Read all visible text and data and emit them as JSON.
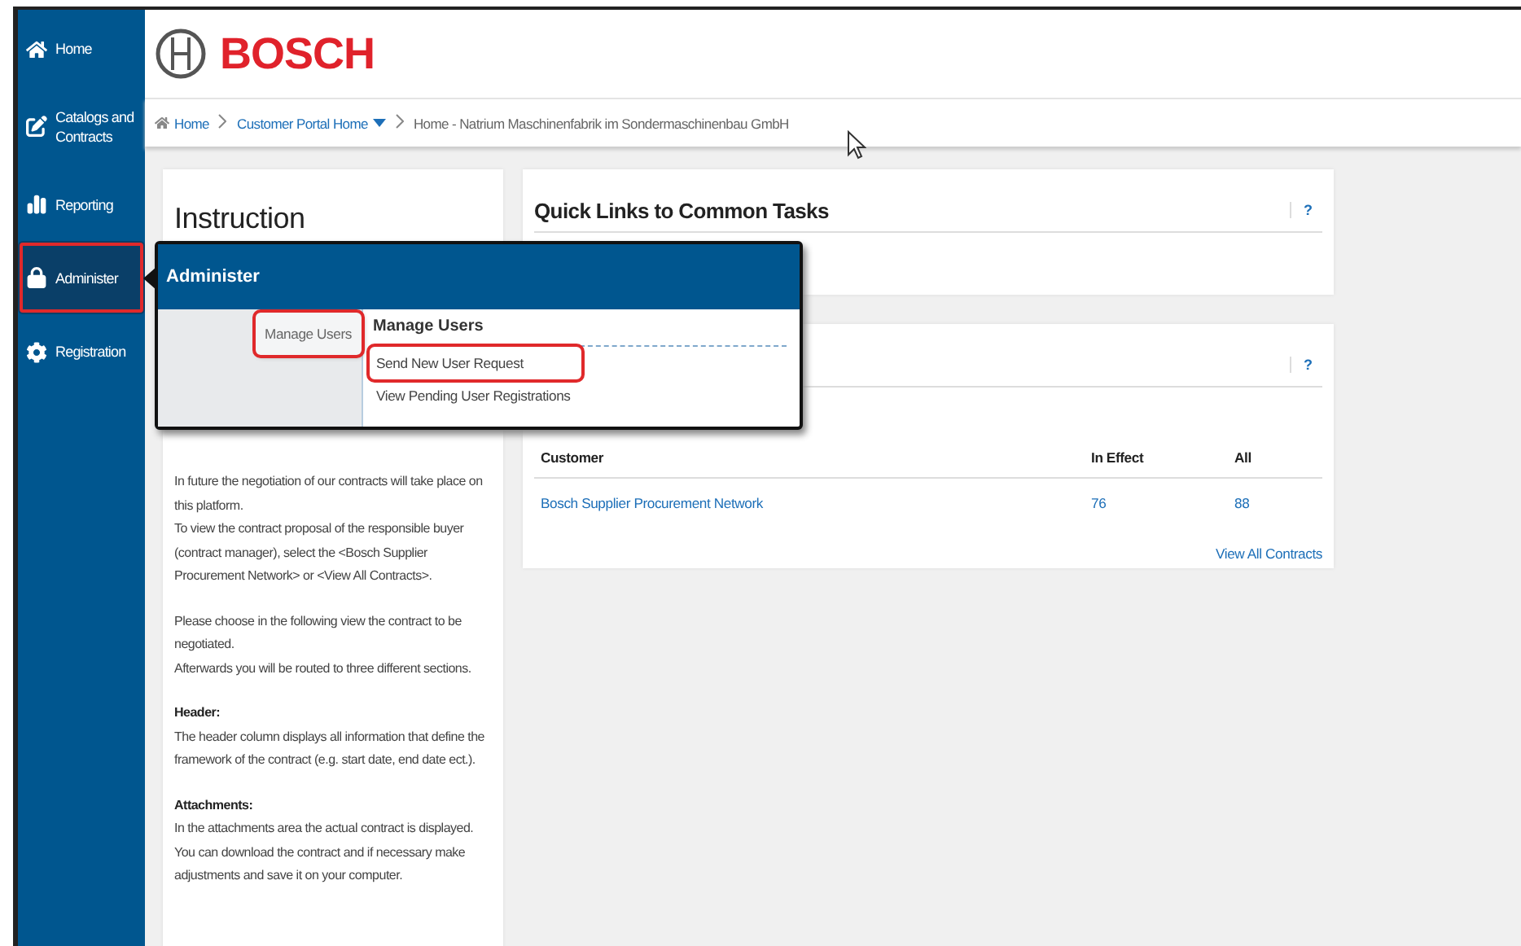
{
  "sidebar": {
    "items": [
      {
        "label": "Home",
        "selected": false,
        "highlighted": false
      },
      {
        "label": "Catalogs and Contracts",
        "selected": false,
        "highlighted": false
      },
      {
        "label": "Reporting",
        "selected": false,
        "highlighted": false
      },
      {
        "label": "Administer",
        "selected": true,
        "highlighted": true
      },
      {
        "label": "Registration",
        "selected": false,
        "highlighted": false
      }
    ]
  },
  "header": {
    "logo_text": "BOSCH"
  },
  "breadcrumb": [
    {
      "label": "Home",
      "kind": "link"
    },
    {
      "label": "Customer Portal Home",
      "kind": "dropdown"
    },
    {
      "label": "Home - Natrium Maschinenfabrik im Sondermaschinenbau GmbH",
      "kind": "text"
    }
  ],
  "instruction": {
    "title": "Instruction",
    "paragraphs": [
      {
        "kind": "text",
        "lines": [
          "In future the negotiation of our contracts will take place on this platform.",
          "To view the contract proposal of the responsible buyer (contract manager), select the <Bosch Supplier Procurement Network> or <View All Contracts>."
        ]
      },
      {
        "kind": "text",
        "lines": [
          "Please choose in the following view the contract to be negotiated.",
          "Afterwards you will be routed to three different sections."
        ]
      },
      {
        "kind": "section",
        "heading": "Header:",
        "lines": [
          "The header column displays all information that define the framework of the contract (e.g. start date, end date ect.)."
        ]
      },
      {
        "kind": "section",
        "heading": "Attachments:",
        "lines": [
          "In the attachments area the actual contract is displayed. You can download the contract and if necessary make adjustments and save it on your computer."
        ]
      }
    ]
  },
  "quick_links": {
    "title": "Quick Links to Common Tasks",
    "help": "?"
  },
  "contracts": {
    "help": "?",
    "columns": [
      "Customer",
      "In Effect",
      "All"
    ],
    "rows": [
      [
        "Bosch Supplier Procurement Network",
        "76",
        "88"
      ]
    ],
    "footer_link": "View All Contracts"
  },
  "popup": {
    "title": "Administer",
    "categories": [
      {
        "label": "Manage Users",
        "selected": true,
        "highlighted": true
      }
    ],
    "section_title": "Manage Users",
    "items": [
      {
        "label": "Send New User Request",
        "highlighted": true
      },
      {
        "label": "View Pending User Registrations",
        "highlighted": false
      }
    ]
  }
}
